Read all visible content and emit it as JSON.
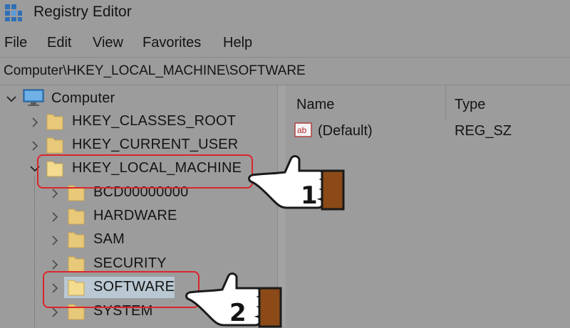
{
  "window": {
    "title": "Registry Editor",
    "icon": "registry-icon"
  },
  "menu": [
    "File",
    "Edit",
    "View",
    "Favorites",
    "Help"
  ],
  "address": "Computer\\HKEY_LOCAL_MACHINE\\SOFTWARE",
  "tree": {
    "root": "Computer",
    "hives": [
      "HKEY_CLASSES_ROOT",
      "HKEY_CURRENT_USER",
      "HKEY_LOCAL_MACHINE"
    ],
    "children": [
      "BCD00000000",
      "HARDWARE",
      "SAM",
      "SECURITY",
      "SOFTWARE",
      "SYSTEM"
    ]
  },
  "values_pane": {
    "columns": [
      "Name",
      "Type"
    ],
    "rows": [
      {
        "icon": "string-value-icon",
        "name": "(Default)",
        "type": "REG_SZ"
      }
    ]
  },
  "annotations": [
    "1",
    "2"
  ],
  "colors": {
    "callout": "#d9262c",
    "folder": "#e8c97a",
    "selection": "#b9c8d2",
    "hand_sleeve": "#8b4a17"
  }
}
